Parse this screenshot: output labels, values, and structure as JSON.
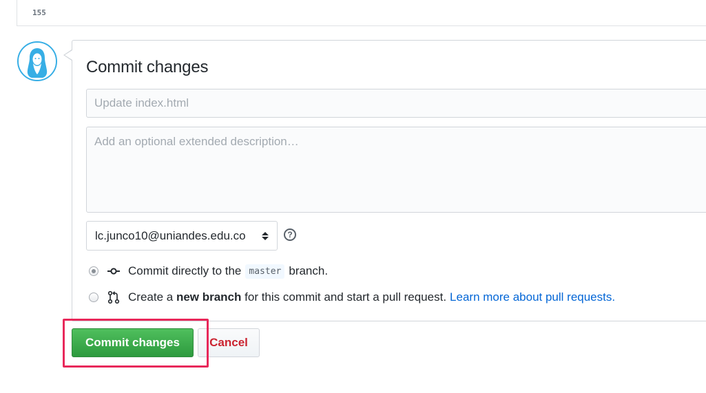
{
  "editor": {
    "line_number": "155"
  },
  "avatar": {
    "icon": "user-avatar-icon"
  },
  "commit_form": {
    "title": "Commit changes",
    "summary_placeholder": "Update index.html",
    "description_placeholder": "Add an optional extended description…",
    "email_select": {
      "selected": "lc.junco10@uniandes.edu.co"
    },
    "help_icon": "question-icon",
    "options": {
      "direct": {
        "checked": true,
        "icon": "git-commit-icon",
        "text_before": "Commit directly to the",
        "branch": "master",
        "text_after": "branch."
      },
      "new_branch": {
        "checked": false,
        "icon": "git-pull-request-icon",
        "text_before": "Create a",
        "emphasis": "new branch",
        "text_after": "for this commit and start a pull request.",
        "link": "Learn more about pull requests."
      }
    },
    "commit_button": "Commit changes",
    "cancel_button": "Cancel"
  },
  "colors": {
    "primary_green": "#2ea44f",
    "link_blue": "#0366d6",
    "cancel_red": "#cb2431",
    "highlight_pink": "#e8285a",
    "avatar_blue": "#37aee5"
  }
}
